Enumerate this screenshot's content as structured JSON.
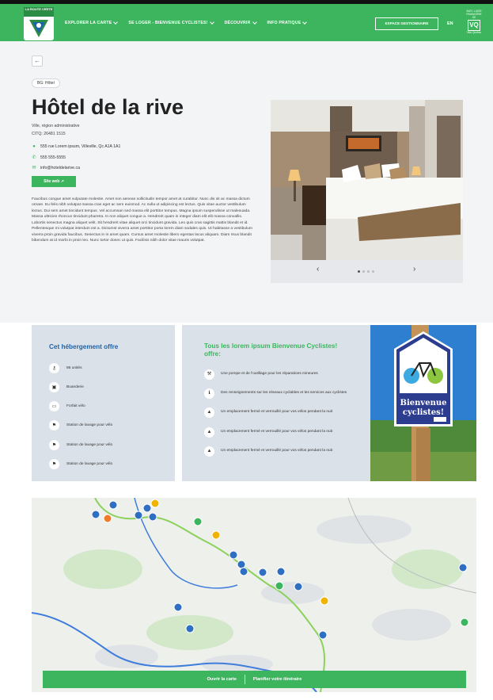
{
  "header": {
    "logo_text": "LA ROUTE VERTE",
    "nav": [
      "EXPLORER LA CARTE",
      "SE LOGER - BIENVENUE CYCLISTES!",
      "DÉCOUVRIR",
      "INFO PRATIQUE"
    ],
    "space_button": "ESPACE GESTIONNAIRE",
    "lang": "EN",
    "partner_caption": "AVEC L'AIDE FINANCIÈRE DE",
    "partner_logo": "VQ",
    "partner_sub": "Vélo Québec"
  },
  "hotel": {
    "tag": "BG: Hôtel",
    "title": "Hôtel de la rive",
    "region": "Ville, région administrative",
    "citq": "CITQ: 26481 1515",
    "address": "555 rue Lorem ipsum, Villeville, Qc  A1A 1A1",
    "phone": "555 555-5555",
    "email": "info@hoteldelarive.ca",
    "web_button": "Site web  ↗",
    "description": "Faucibus congue amet vulputate molestie. Amet non aenean sollicitudin tempor amet at curabitur. Nunc dis sit ac massa dictum ornare. Eu felis nibh volutpat massa cras eget ac sem euismod. Ac nulla ut adipiscing est lectus. Quis vitae auctor vestibulum lectus. Dui sem amet tincidunt tempus. Vel accumsan sed massa elit porttitor tempus. Magna ipsum suspendisse ut malesuada. Massa ultricies rhoncus tincidunt pharetra. In non aliquet congue a. Hendrerit quam in integer diam elit elit massa convallis. Lobortis senectus magna aliquet velit. Sit hendrerit vitae aliquet orci tincidunt gravida. Leo quis cras sagittis mattis blandit et id. Pellentesque mi volutpat interdum est a. Dictumst viverra amet porttitor porta lorem diam sodales quis. Ut habitasse a vestibulum viverra proin gravida faucibus. Senectus in in amet quam. Cursus amet molestie libero egestas lacus aliquam. Diam risus blandit bibendum at id morbi in proin leo. Nunc tortor donec ut quis. Facilisis nibh dolor vitae mauris volutpat."
  },
  "gallery": {
    "prev": "‹",
    "next": "›",
    "slides": 4,
    "active": 1
  },
  "offers": {
    "title": "Cet hébergement offre",
    "items": [
      {
        "icon": "key-icon",
        "label": "86 unités"
      },
      {
        "icon": "luggage-icon",
        "label": "Buanderie"
      },
      {
        "icon": "ticket-icon",
        "label": "Forfait vélo"
      },
      {
        "icon": "wash-station-icon",
        "label": "Station de lavage pour vélo"
      },
      {
        "icon": "wash-station-icon",
        "label": "Station de lavage pour vélo"
      },
      {
        "icon": "wash-station-icon",
        "label": "Station de lavage pour vélo"
      }
    ]
  },
  "cyclists": {
    "title": "Tous les lorem ipsum Bienvenue Cyclistes! offre:",
    "items": [
      {
        "icon": "tools-icon",
        "label": "Une pompe et de l'outillage pour les réparations mineures"
      },
      {
        "icon": "info-icon",
        "label": "Des renseignements sur les réseaux cyclables et les services aux cyclistes"
      },
      {
        "icon": "lock-icon",
        "label": "Un emplacement fermé et verrouillé pour vos vélos pendant la nuit"
      },
      {
        "icon": "lock-icon",
        "label": "Un emplacement fermé et verrouillé pour vos vélos pendant la nuit"
      },
      {
        "icon": "lock-icon",
        "label": "Un emplacement fermé et verrouillé pour vos vélos pendant la nuit"
      }
    ]
  },
  "sign": {
    "line1": "Bienvenue",
    "line2": "cyclistes!"
  },
  "map": {
    "open_map": "Ouvrir la carte",
    "plan_itinerary": "Planifier votre itinéraire"
  },
  "colors": {
    "brand_green": "#3cb55e",
    "title_blue": "#1e63a8",
    "panel_gray": "#dbe1e8"
  }
}
